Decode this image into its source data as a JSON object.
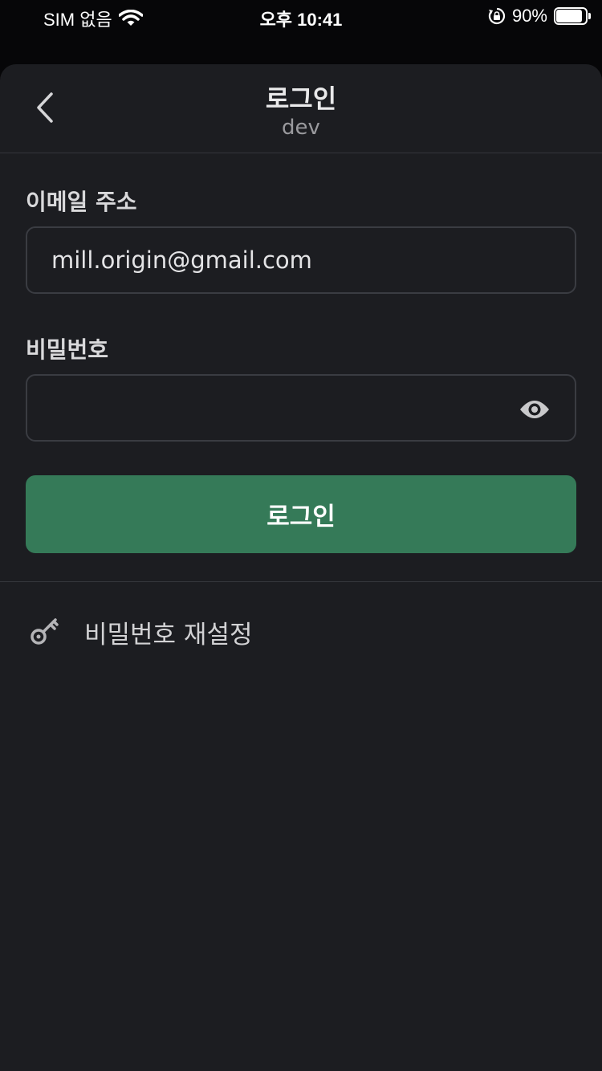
{
  "status_bar": {
    "carrier": "SIM 없음",
    "time": "오후 10:41",
    "battery_percent": "90%",
    "battery_level": 0.9,
    "icons": [
      "wifi-icon",
      "lock-rotation-icon",
      "battery-icon"
    ]
  },
  "header": {
    "title": "로그인",
    "subtitle": "dev",
    "back_icon": "chevron-left-icon"
  },
  "form": {
    "email_label": "이메일 주소",
    "email_value": "mill.origin@gmail.com",
    "password_label": "비밀번호",
    "password_value": "",
    "password_toggle_icon": "eye-icon",
    "login_button_label": "로그인"
  },
  "links": {
    "reset_password_label": "비밀번호 재설정",
    "reset_password_icon": "key-icon"
  },
  "colors": {
    "background": "#1c1d21",
    "status_background": "#060608",
    "accent": "#357a58",
    "border": "#3a3c42",
    "text": "#e9e9ea",
    "muted_text": "#9a9a9e"
  }
}
